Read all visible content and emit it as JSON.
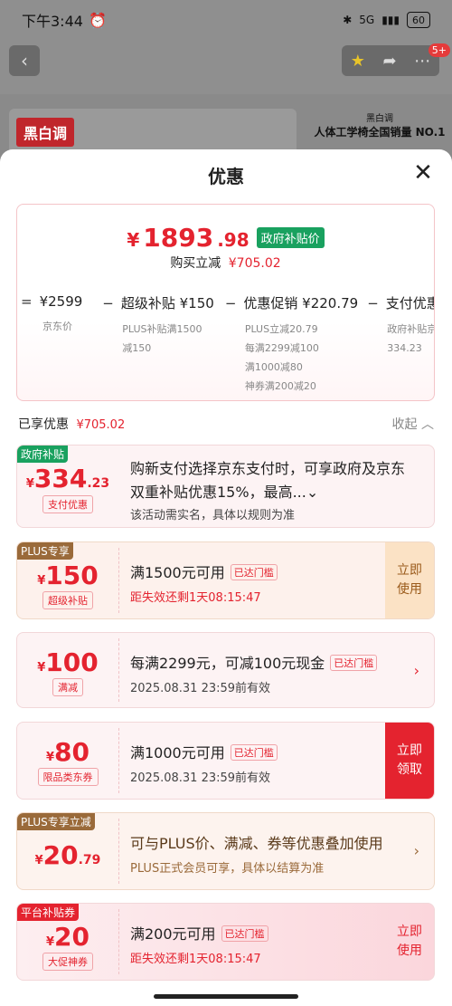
{
  "status": {
    "time": "下午3:44",
    "network": "5G",
    "battery": "60"
  },
  "nav": {
    "badge": "5+"
  },
  "background": {
    "brand_tag": "黑白调",
    "side_brand": "黑白调",
    "side_title": "人体工学椅全国销量 NO.1"
  },
  "sheet": {
    "title": "优惠",
    "summary": {
      "price_symbol": "¥",
      "price_int": "1893",
      "price_dec": ".98",
      "gov_tag": "政府补贴价",
      "reduce_label": "购买立减",
      "reduce_amount": "¥705.02",
      "breakdown": [
        {
          "op": "=",
          "value": "¥2599",
          "subs": [
            "京东价"
          ]
        },
        {
          "op": "−",
          "value": "超级补贴 ¥150",
          "subs": [
            "PLUS补贴满1500",
            "减150"
          ]
        },
        {
          "op": "−",
          "value": "优惠促销 ¥220.79",
          "subs": [
            "PLUS立减20.79",
            "每满2299减100",
            "满1000减80",
            "神券满200减20"
          ]
        },
        {
          "op": "−",
          "value": "支付优惠 ¥",
          "subs": [
            "政府补贴京东",
            "334.23"
          ]
        }
      ]
    },
    "enjoyed_label": "已享优惠",
    "enjoyed_amount": "¥705.02",
    "collapse_label": "收起 ︿",
    "coupons": [
      {
        "tag": "政府补贴",
        "sym": "¥",
        "amount": "334",
        "dec": ".23",
        "label": "支付优惠",
        "line1": "购新支付选择京东支付时，可享政府及京东",
        "line1b": "双重补贴优惠15%，最高...⌄",
        "line2": "该活动需实名，具体以规则为准"
      },
      {
        "tag": "PLUS专享",
        "sym": "¥",
        "amount": "150",
        "label": "超级补贴",
        "line1": "满1500元可用",
        "reached": "已达门槛",
        "line2": "距失效还剩1天08:15:47",
        "action1": "立即",
        "action2": "使用"
      },
      {
        "sym": "¥",
        "amount": "100",
        "label": "满减",
        "line1": "每满2299元，可减100元现金",
        "reached": "已达门槛",
        "line2": "2025.08.31 23:59前有效"
      },
      {
        "sym": "¥",
        "amount": "80",
        "label": "限品类东券",
        "line1": "满1000元可用",
        "reached": "已达门槛",
        "line2": "2025.08.31 23:59前有效",
        "action1": "立即",
        "action2": "领取"
      },
      {
        "tag": "PLUS专享立减",
        "sym": "¥",
        "amount": "20",
        "dec": ".79",
        "line1": "可与PLUS价、满减、券等优惠叠加使用",
        "line2": "PLUS正式会员可享，具体以结算为准"
      },
      {
        "tag": "平台补贴券",
        "sym": "¥",
        "amount": "20",
        "label": "大促神券",
        "line1": "满200元可用",
        "reached": "已达门槛",
        "line2": "距失效还剩1天08:15:47",
        "action1": "立即",
        "action2": "使用"
      }
    ]
  },
  "colors": {
    "accent": "#e4232f",
    "gov_green": "#19a15f",
    "plus_brown": "#9a6a3a"
  }
}
